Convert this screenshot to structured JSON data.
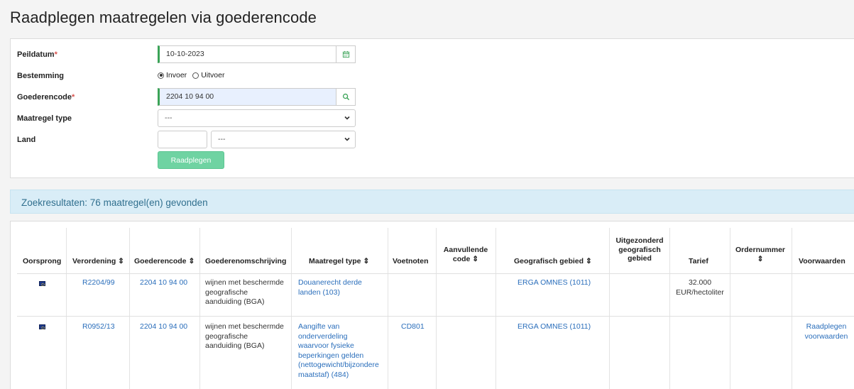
{
  "page": {
    "title": "Raadplegen maatregelen via goederencode"
  },
  "form": {
    "peildatum": {
      "label": "Peildatum",
      "required_mark": "*",
      "value": "10-10-2023",
      "icon": "calendar-icon"
    },
    "bestemming": {
      "label": "Bestemming",
      "options": [
        "Invoer",
        "Uitvoer"
      ],
      "selected": "Invoer"
    },
    "goederencode": {
      "label": "Goederencode",
      "required_mark": "*",
      "value": "2204 10 94 00",
      "icon": "search-icon"
    },
    "maatregel_type": {
      "label": "Maatregel type",
      "value": "---"
    },
    "land": {
      "label": "Land",
      "code_value": "",
      "select_value": "---"
    },
    "submit_label": "Raadplegen"
  },
  "results": {
    "summary": "Zoekresultaten: 76 maatregel(en) gevonden"
  },
  "table": {
    "headers": {
      "oorsprong": "Oorsprong",
      "verordening": "Verordening ⇕",
      "goederencode": "Goederencode ⇕",
      "omschrijving": "Goederenomschrijving",
      "maatregel": "Maatregel type ⇕",
      "voetnoten": "Voetnoten",
      "aanvullende_1": "Aanvullende",
      "aanvullende_2": "code ⇕",
      "geo": "Geografisch gebied ⇕",
      "uitgez_1": "Uitgezonderd",
      "uitgez_2": "geografisch",
      "uitgez_3": "gebied",
      "tarief": "Tarief",
      "order_1": "Ordernummer",
      "order_2": "⇕",
      "voorwaarden": "Voorwaarden"
    },
    "rows": [
      {
        "oorsprong_icon": "eu-flag-icon",
        "verordening": "R2204/99",
        "goederencode": "2204 10 94 00",
        "omschrijving": [
          "wijnen met beschermde",
          "geografische",
          "aanduiding (BGA)"
        ],
        "maatregel": [
          "Douanerecht derde",
          "landen (103)"
        ],
        "voetnoten": "",
        "aanvullende": "",
        "geo": "ERGA OMNES (1011)",
        "uitgezonderd": "",
        "tarief": [
          "32.000",
          "EUR/hectoliter"
        ],
        "ordernummer": "",
        "voorwaarden": []
      },
      {
        "oorsprong_icon": "eu-flag-icon",
        "verordening": "R0952/13",
        "goederencode": "2204 10 94 00",
        "omschrijving": [
          "wijnen met beschermde",
          "geografische",
          "aanduiding (BGA)"
        ],
        "maatregel": [
          "Aangifte van",
          "onderverdeling",
          "waarvoor fysieke",
          "beperkingen gelden",
          "(nettogewicht/bijzondere",
          "maatstaf) (484)"
        ],
        "voetnoten": "CD801",
        "aanvullende": "",
        "geo": "ERGA OMNES (1011)",
        "uitgezonderd": "",
        "tarief": [],
        "ordernummer": "",
        "voorwaarden": [
          "Raadplegen",
          "voorwaarden"
        ]
      }
    ]
  },
  "colors": {
    "accent_green": "#3aa357",
    "button_green": "#6fd3a2",
    "link_blue": "#2a6ebb",
    "banner_bg": "#d9edf7",
    "banner_text": "#31708f",
    "required_red": "#d9534f"
  }
}
